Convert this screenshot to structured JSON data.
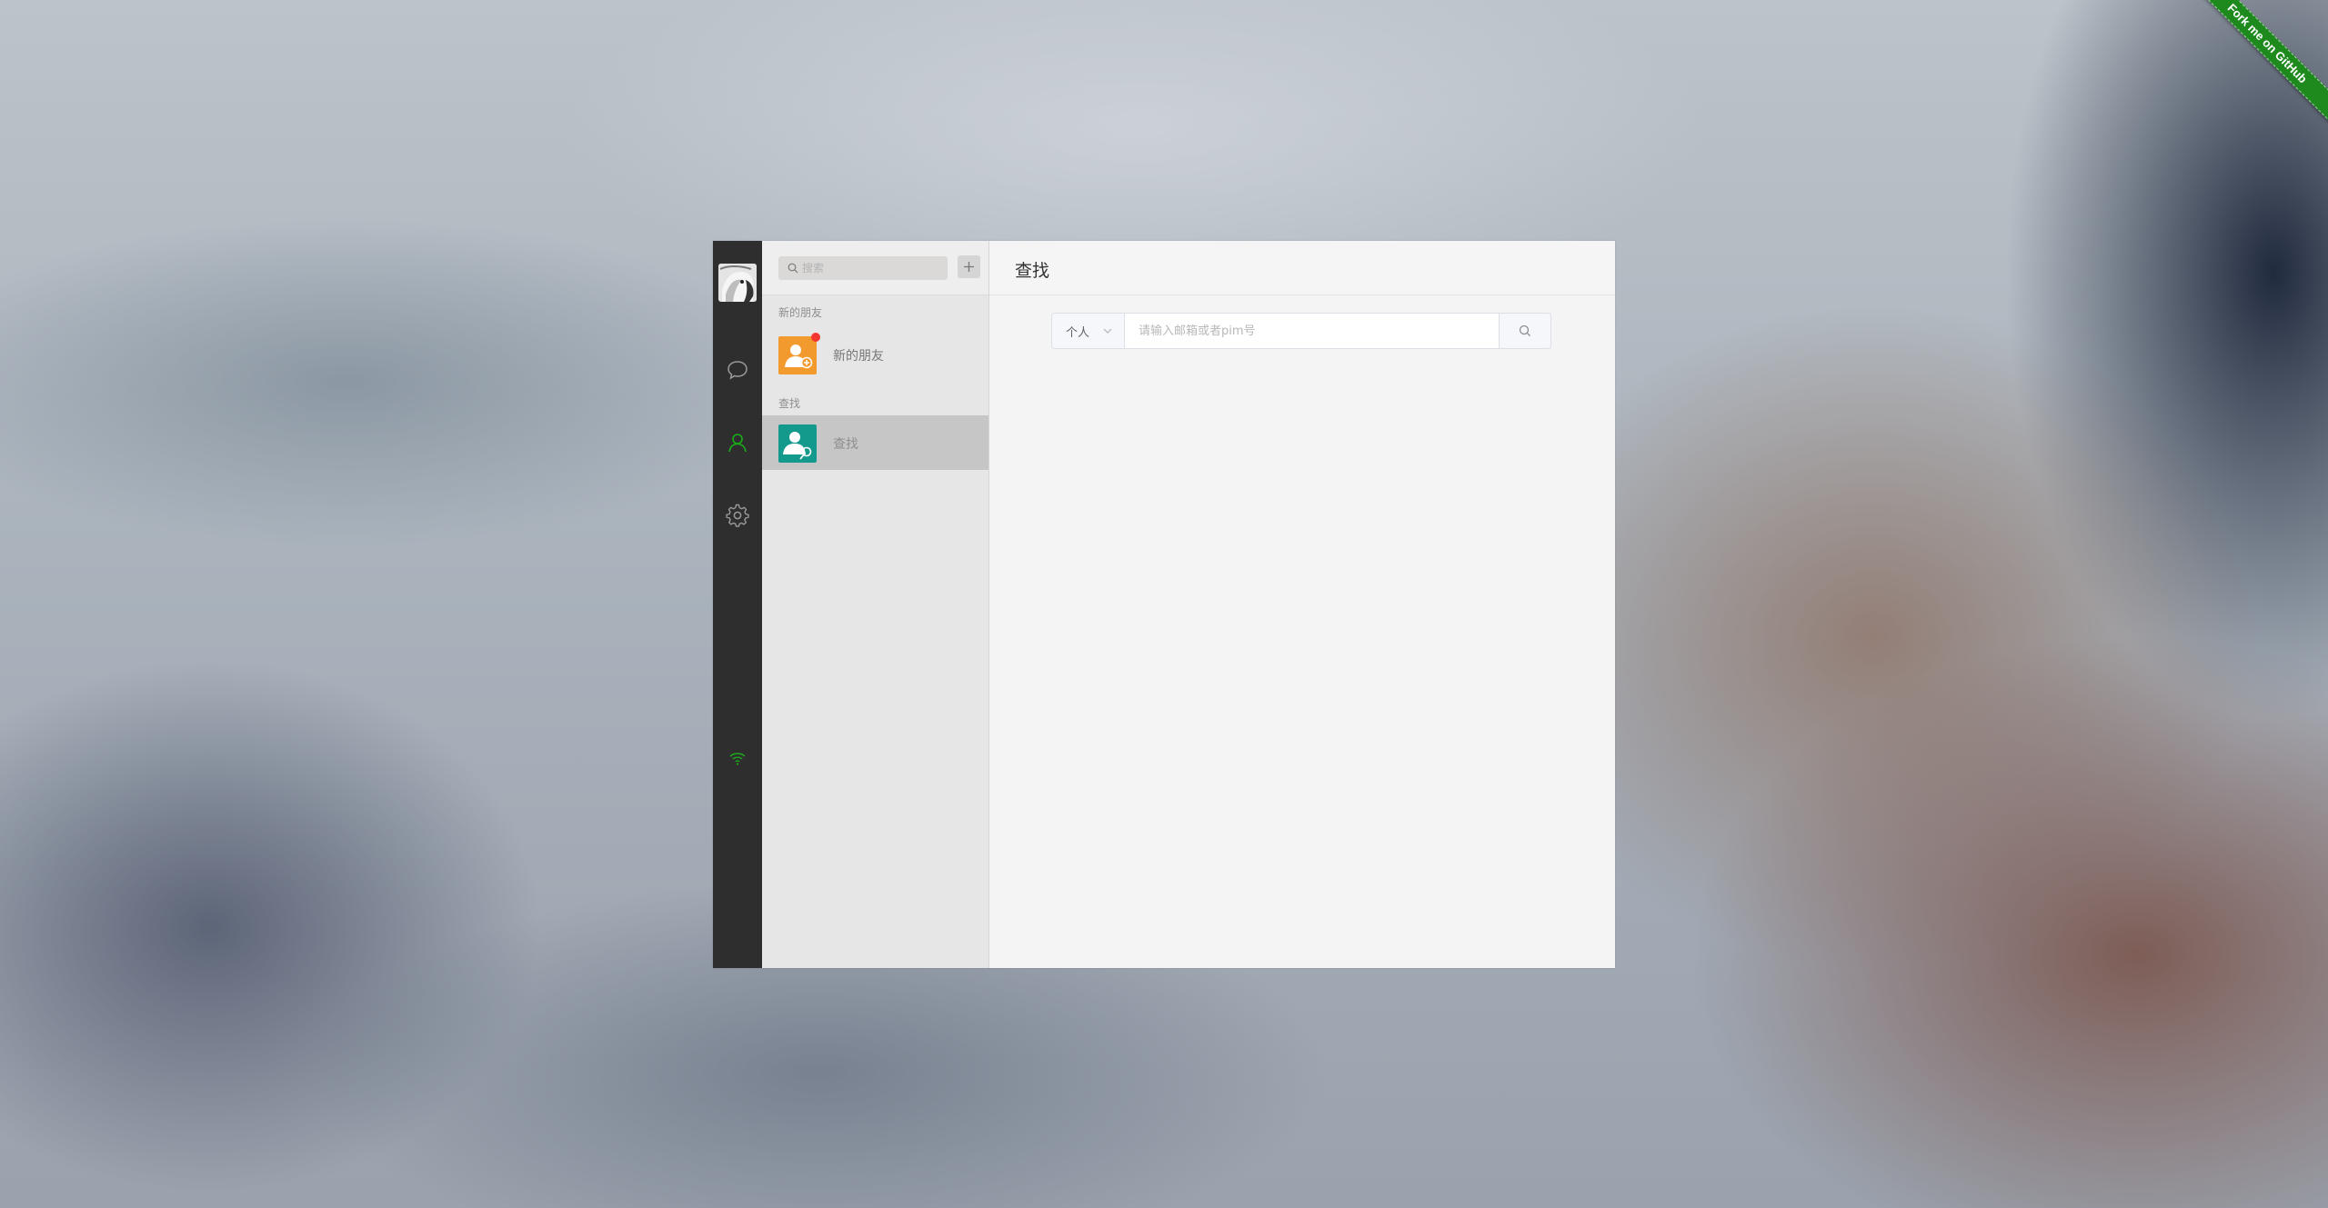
{
  "ribbon": {
    "label": "Fork me on GitHub",
    "color": "#1e8a1e"
  },
  "sidebar": {
    "icons": [
      {
        "name": "chat-icon",
        "active": false
      },
      {
        "name": "contacts-icon",
        "active": true
      },
      {
        "name": "settings-icon",
        "active": false
      }
    ],
    "status_icon": "wifi-icon",
    "accent": "#1aad19"
  },
  "listpane": {
    "search": {
      "placeholder": "搜索"
    },
    "add_label": "+",
    "groups": [
      {
        "label": "新的朋友",
        "items": [
          {
            "name": "新的朋友",
            "badge": true,
            "avatar_color": "#f39a2e"
          }
        ]
      },
      {
        "label": "查找",
        "items": [
          {
            "name": "查找",
            "active": true,
            "avatar_color": "#14998d"
          }
        ]
      }
    ]
  },
  "content": {
    "title": "查找",
    "finder": {
      "type_value": "个人",
      "placeholder": "请输入邮箱或者pim号"
    }
  }
}
